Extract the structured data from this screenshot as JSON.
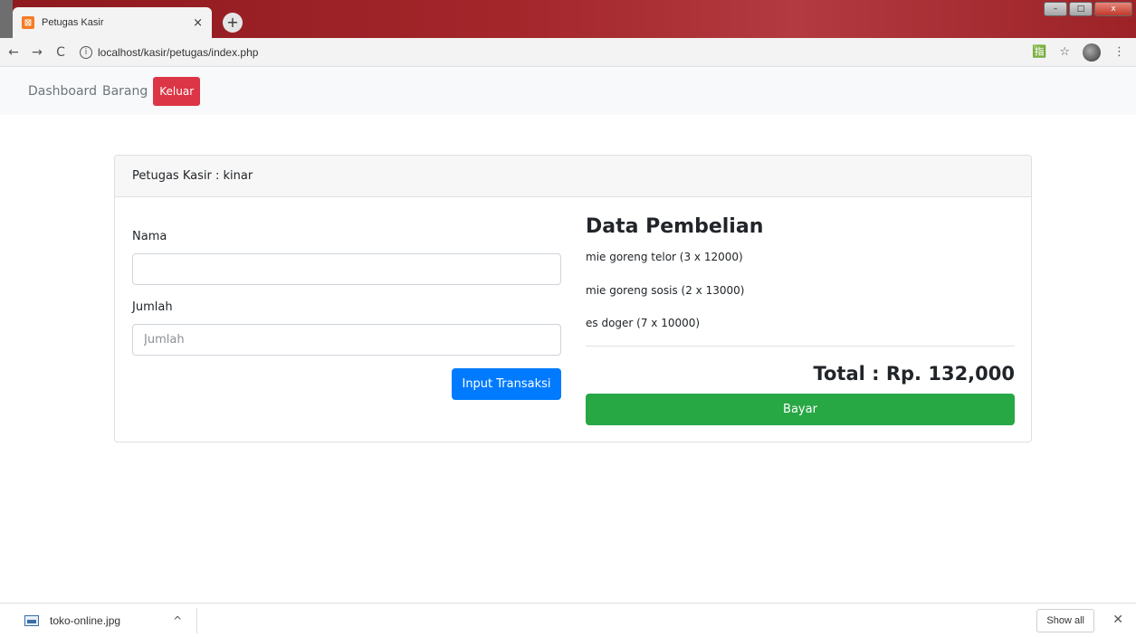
{
  "browser": {
    "tab_title": "Petugas Kasir",
    "tab_close": "×",
    "new_tab": "+",
    "url": "localhost/kasir/petugas/index.php",
    "back": "←",
    "forward": "→",
    "reload": "C",
    "info": "i",
    "translate": "🈯",
    "star": "☆",
    "menu": "⋮",
    "minimize": "–",
    "maximize": "□",
    "close": "x"
  },
  "navbar": {
    "links": [
      "Dashboard",
      "Barang"
    ],
    "logout_label": "Keluar"
  },
  "card": {
    "header": "Petugas Kasir : kinar",
    "form": {
      "nama_label": "Nama",
      "nama_value": "",
      "jumlah_label": "Jumlah",
      "jumlah_placeholder": "Jumlah",
      "submit_label": "Input Transaksi"
    },
    "purchase": {
      "title": "Data Pembelian",
      "items": [
        "mie goreng telor (3 x 12000)",
        "mie goreng sosis (2 x 13000)",
        "es doger (7 x 10000)"
      ],
      "total": "Total : Rp. 132,000",
      "pay_label": "Bayar"
    }
  },
  "download_bar": {
    "file_name": "toko-online.jpg",
    "chevron": "^",
    "show_all": "Show all",
    "close": "✕"
  },
  "colors": {
    "primary": "#007bff",
    "danger": "#dc3545",
    "success": "#28a745"
  }
}
